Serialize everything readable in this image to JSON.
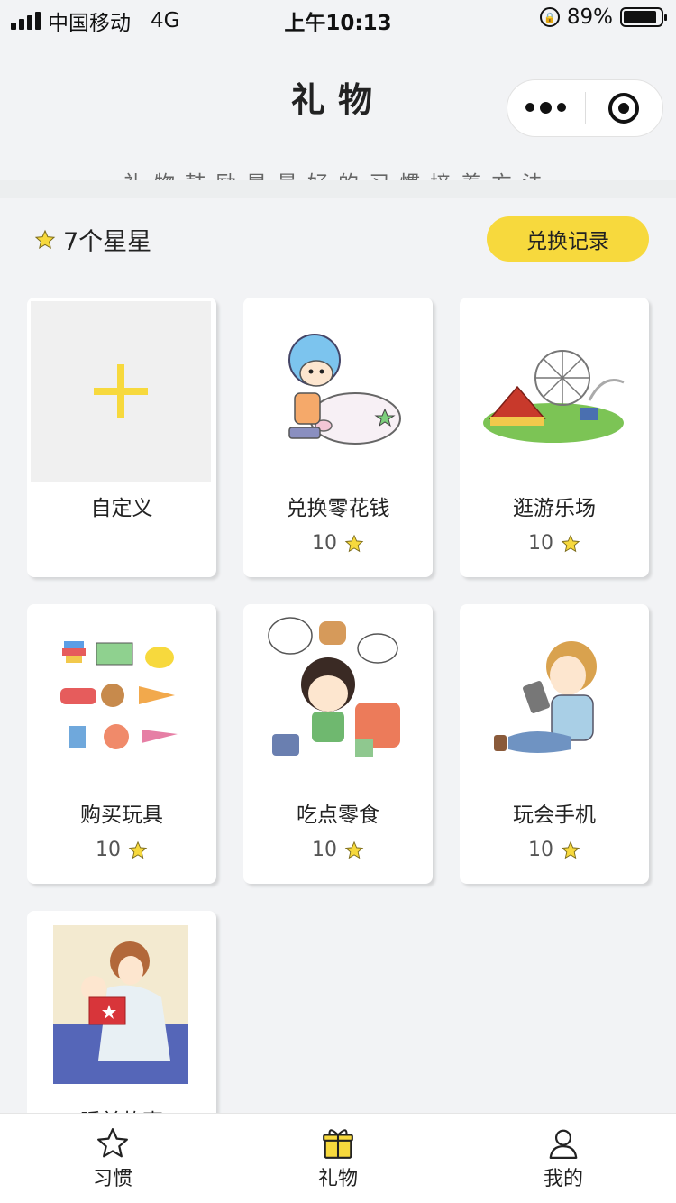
{
  "status_bar": {
    "carrier": "中国移动",
    "network": "4G",
    "time": "上午10:13",
    "battery": "89%",
    "battery_level": 0.89
  },
  "header": {
    "title": "礼物",
    "subtitle": "礼物鼓励是最好的习惯培养方法"
  },
  "summary": {
    "stars_text": "7个星星",
    "redeem_button": "兑换记录"
  },
  "gifts": [
    {
      "name": "自定义",
      "cost": "",
      "icon": "plus-icon"
    },
    {
      "name": "兑换零花钱",
      "cost": "10",
      "icon": "piggy-bank-illustration"
    },
    {
      "name": "逛游乐场",
      "cost": "10",
      "icon": "amusement-park-illustration"
    },
    {
      "name": "购买玩具",
      "cost": "10",
      "icon": "toys-illustration"
    },
    {
      "name": "吃点零食",
      "cost": "10",
      "icon": "snacks-illustration"
    },
    {
      "name": "玩会手机",
      "cost": "10",
      "icon": "phone-illustration"
    },
    {
      "name": "睡前故事",
      "cost": "",
      "icon": "bedtime-story-illustration"
    }
  ],
  "tabbar": [
    {
      "label": "习惯",
      "icon": "star-outline-icon"
    },
    {
      "label": "礼物",
      "icon": "gift-icon"
    },
    {
      "label": "我的",
      "icon": "user-icon"
    }
  ],
  "colors": {
    "accent": "#f7d93d",
    "background": "#f2f3f5"
  }
}
